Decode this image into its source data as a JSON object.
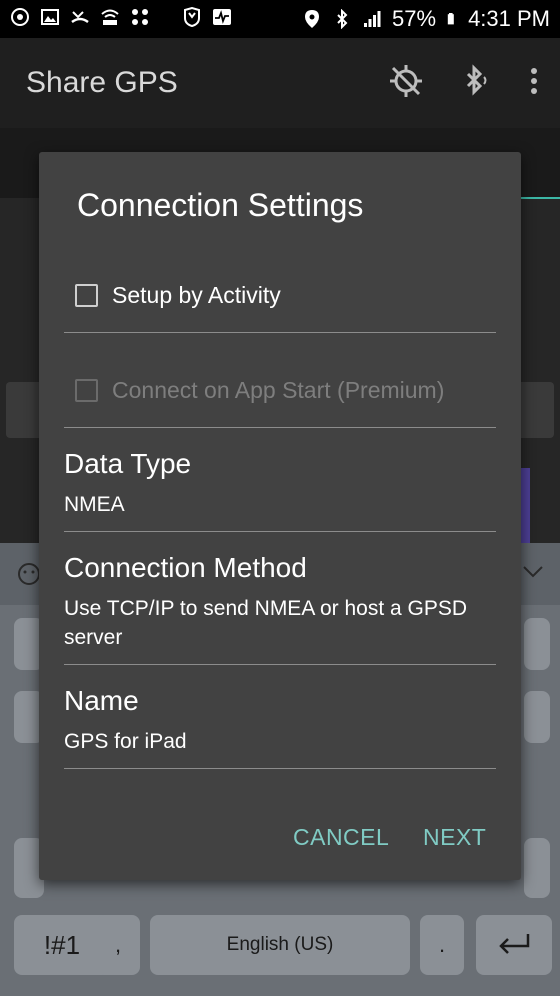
{
  "status_bar": {
    "battery": "57%",
    "time": "4:31 PM"
  },
  "app_bar": {
    "title": "Share GPS"
  },
  "keyboard": {
    "symbols_key": "!#1",
    "comma_key": ",",
    "space_key": "English (US)",
    "period_key": "."
  },
  "dialog": {
    "title": "Connection Settings",
    "checkboxes": [
      {
        "label": "Setup by Activity",
        "checked": false,
        "enabled": true
      },
      {
        "label": "Connect on App Start (Premium)",
        "checked": false,
        "enabled": false
      }
    ],
    "preferences": [
      {
        "title": "Data Type",
        "summary": "NMEA"
      },
      {
        "title": "Connection Method",
        "summary": "Use TCP/IP to send NMEA or host a GPSD server"
      },
      {
        "title": "Name",
        "summary": "GPS for iPad"
      }
    ],
    "cancel_label": "CANCEL",
    "next_label": "NEXT"
  },
  "colors": {
    "accent": "#80cbc4",
    "dialog_bg": "#424242"
  }
}
